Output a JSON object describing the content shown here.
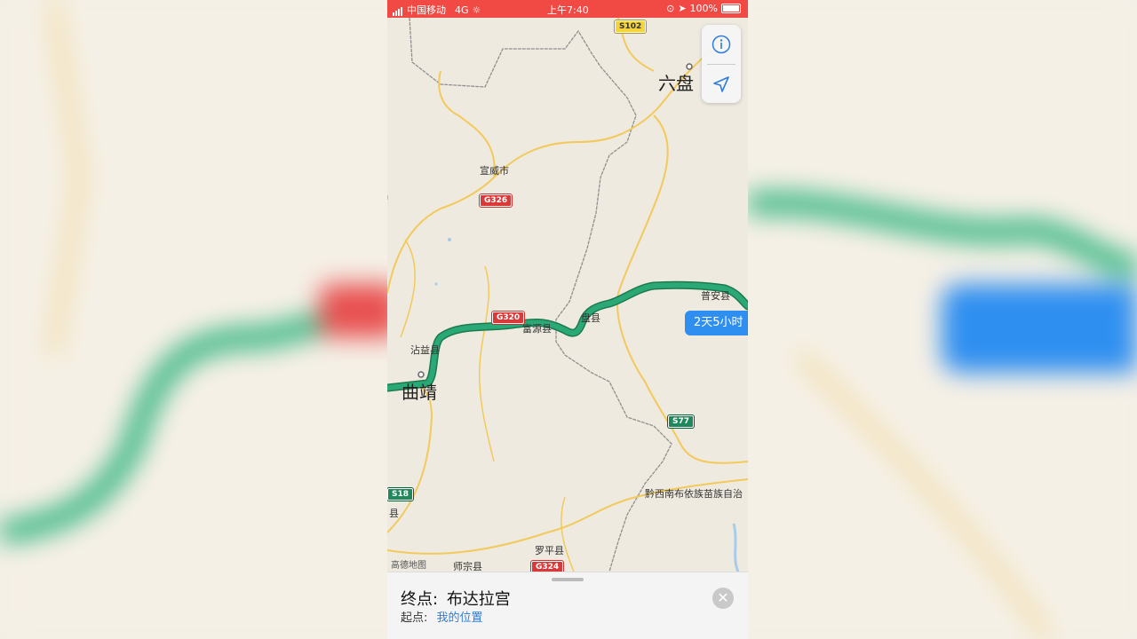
{
  "status": {
    "carrier": "中国移动",
    "network": "4G",
    "time": "上午7:40",
    "battery": "100%"
  },
  "map": {
    "labels": {
      "liupan": "六盘",
      "xuanwei": "宣威市",
      "zhanyi": "沾益县",
      "qujing": "曲靖",
      "fuyuan": "富源县",
      "panxian": "盘县",
      "puan": "普安县",
      "qianxinan": "黔西南布依族苗族自治",
      "luoping": "罗平县",
      "shizong": "师宗县",
      "xian": "县",
      "gaode": "高德地图"
    },
    "shields": {
      "s102": "S102",
      "g326": "G326",
      "g320": "G320",
      "s77": "S77",
      "s18": "S18",
      "g324": "G324"
    },
    "route_eta": "2天5小时",
    "route_color": "#2aa876"
  },
  "controls": {
    "info_icon": "info-icon",
    "location_icon": "location-arrow-icon"
  },
  "sheet": {
    "destination_label": "终点:",
    "destination": "布达拉宫",
    "origin_label": "起点:",
    "origin": "我的位置",
    "close_icon": "close-icon"
  }
}
